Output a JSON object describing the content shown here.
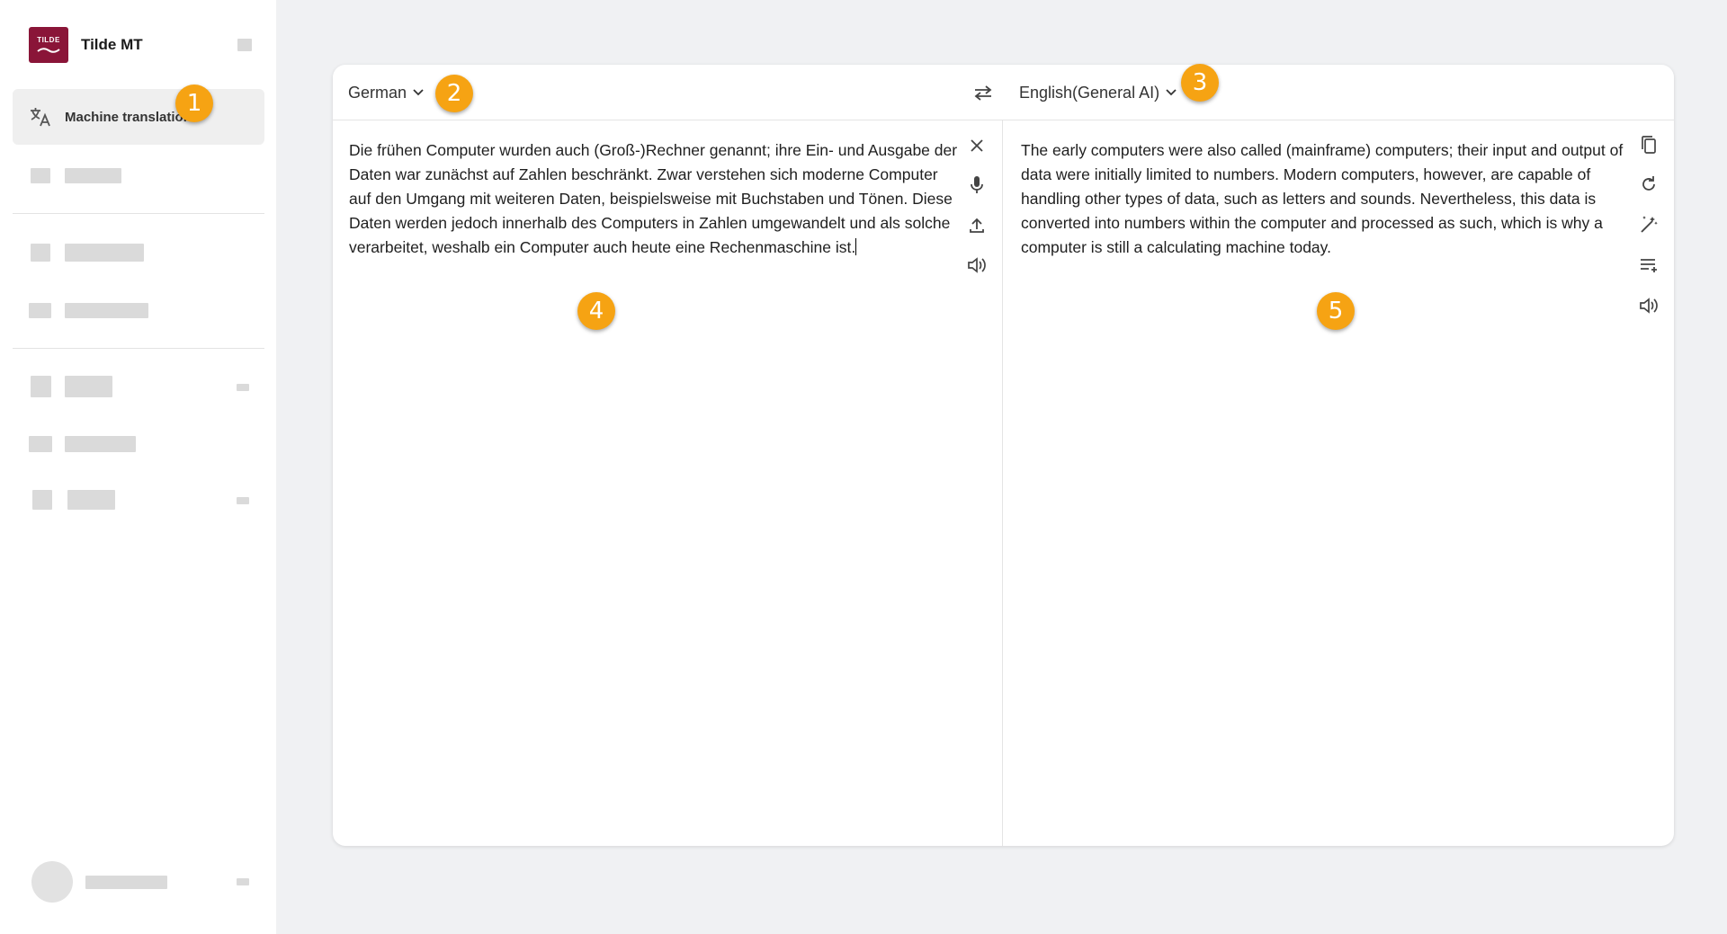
{
  "app": {
    "name": "Tilde MT",
    "logo_text": "TILDE"
  },
  "sidebar": {
    "active_item": {
      "label": "Machine translation",
      "icon": "translate-icon"
    }
  },
  "translator": {
    "source_language": "German",
    "target_language": "English(General AI)",
    "source_text": "Die frühen Computer wurden auch (Groß-)Rechner genannt; ihre Ein- und Ausgabe der Daten war zunächst auf Zahlen beschränkt. Zwar verstehen sich moderne Computer auf den Umgang mit weiteren Daten, beispielsweise mit Buchstaben und Tönen. Diese Daten werden jedoch innerhalb des Computers in Zahlen umgewandelt und als solche verarbeitet, weshalb ein Computer auch heute eine Rechenmaschine ist.",
    "target_text": "The early computers were also called (mainframe) computers; their input and output of data were initially limited to numbers. Modern computers, however, are capable of handling other types of data, such as letters and sounds. Nevertheless, this data is converted into numbers within the computer and processed as such, which is why a computer is still a calculating machine today.",
    "source_tools": [
      "close-icon",
      "microphone-icon",
      "upload-icon",
      "speaker-icon"
    ],
    "target_tools": [
      "copy-icon",
      "refresh-icon",
      "magic-wand-icon",
      "glossary-icon",
      "speaker-icon"
    ]
  },
  "callouts": [
    "1",
    "2",
    "3",
    "4",
    "5"
  ],
  "colors": {
    "brand": "#8a1538",
    "callout": "#f6a313",
    "background": "#f0f1f3"
  }
}
